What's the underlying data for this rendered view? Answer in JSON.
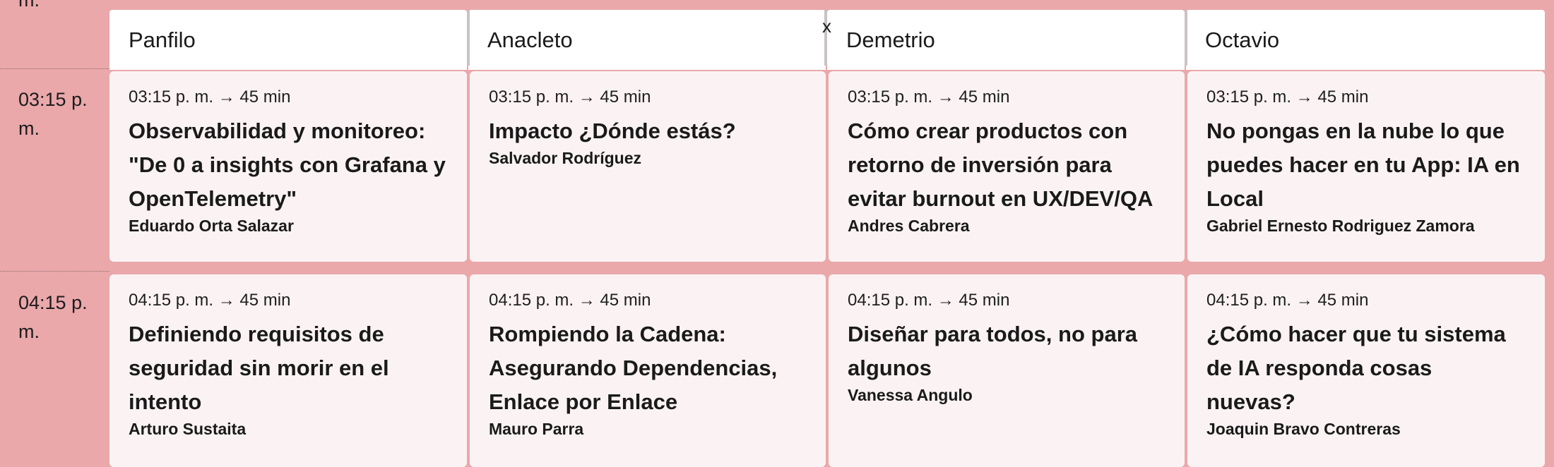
{
  "partial_time_label": "m.",
  "stray_glyph": "x",
  "tracks": [
    "Panfilo",
    "Anacleto",
    "Demetrio",
    "Octavio"
  ],
  "slots": [
    {
      "time": "03:15 p. m.",
      "sessions": [
        {
          "meta": "03:15 p. m. → 45 min",
          "title": "Observabilidad y monitoreo: \"De 0 a insights con Grafana y OpenTelemetry\"",
          "speaker": "Eduardo Orta Salazar"
        },
        {
          "meta": "03:15 p. m. → 45 min",
          "title": "Impacto ¿Dónde estás?",
          "speaker": "Salvador Rodríguez"
        },
        {
          "meta": "03:15 p. m. → 45 min",
          "title": "Cómo crear productos con retorno de inversión para evitar burnout en UX/DEV/QA",
          "speaker": "Andres Cabrera"
        },
        {
          "meta": "03:15 p. m. → 45 min",
          "title": "No pongas en la nube lo que puedes hacer en tu App: IA en Local",
          "speaker": "Gabriel Ernesto Rodriguez Zamora"
        }
      ]
    },
    {
      "time": "04:15 p. m.",
      "sessions": [
        {
          "meta": "04:15 p. m. → 45 min",
          "title": "Definiendo requisitos de seguridad sin morir en el intento",
          "speaker": "Arturo Sustaita"
        },
        {
          "meta": "04:15 p. m. → 45 min",
          "title": "Rompiendo la Cadena: Asegurando Dependencias, Enlace por Enlace",
          "speaker": "Mauro Parra"
        },
        {
          "meta": "04:15 p. m. → 45 min",
          "title": "Diseñar para todos, no para algunos",
          "speaker": "Vanessa Angulo"
        },
        {
          "meta": "04:15 p. m. → 45 min",
          "title": "¿Cómo hacer que tu sistema de IA responda cosas nuevas?",
          "speaker": "Joaquin Bravo Contreras"
        }
      ]
    }
  ],
  "colors": {
    "background": "#eaa8ab",
    "cell": "#fbf3f3",
    "header": "#ffffff"
  }
}
